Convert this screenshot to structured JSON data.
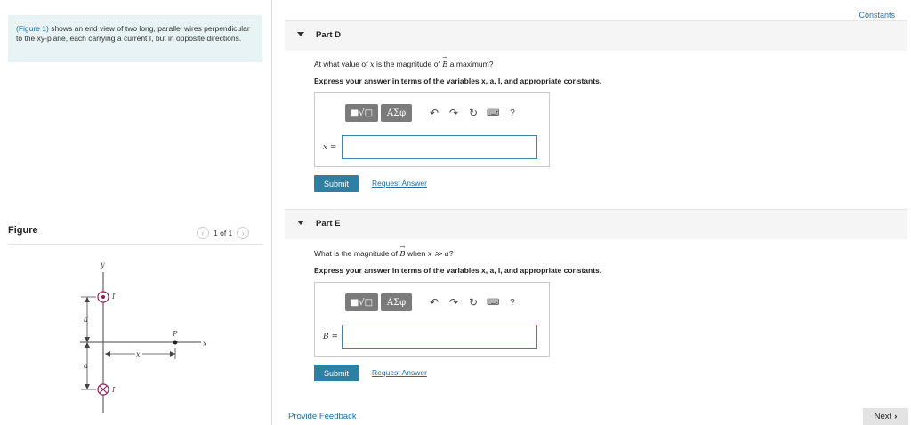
{
  "left_panel": {
    "info_link": "(Figure 1)",
    "info_text": " shows an end view of two long, parallel wires perpendicular to the xy-plane, each carrying a current I, but in opposite directions.",
    "figure_title": "Figure",
    "pager": {
      "prev_icon": "chevron-left-icon",
      "label": "1 of 1",
      "next_icon": "chevron-right-icon"
    },
    "diagram": {
      "y_label": "y",
      "x_label": "x",
      "current_top": "I",
      "current_bottom": "I",
      "point_label": "P",
      "a_top": "a",
      "a_bottom": "a",
      "x_dim": "x",
      "wire_color": "#8b1e5a"
    }
  },
  "constants_link": "Constants",
  "parts": [
    {
      "title": "Part D",
      "question_pre": "At what value of ",
      "question_var": "x",
      "question_mid": " is the magnitude of ",
      "question_vec": "B",
      "question_post": " a maximum?",
      "express": "Express your answer in terms of the variables x, a, I, and appropriate constants.",
      "toolbar": {
        "templates": "■√□",
        "greek": "ΑΣφ",
        "undo": "undo-icon",
        "redo": "redo-icon",
        "reset": "reset-icon",
        "keyboard": "keyboard-icon",
        "help": "?"
      },
      "answer_var": "x =",
      "answer_value": "",
      "submit": "Submit",
      "request": "Request Answer"
    },
    {
      "title": "Part E",
      "question_pre": "What is the magnitude of ",
      "question_vec": "B",
      "question_mid": " when ",
      "question_cond": "x ≫ a",
      "question_post": "?",
      "express": "Express your answer in terms of the variables x, a, I, and appropriate constants.",
      "toolbar": {
        "templates": "■√□",
        "greek": "ΑΣφ",
        "undo": "undo-icon",
        "redo": "redo-icon",
        "reset": "reset-icon",
        "keyboard": "keyboard-icon",
        "help": "?"
      },
      "answer_var": "B =",
      "answer_value": "",
      "submit": "Submit",
      "request": "Request Answer"
    }
  ],
  "footer": {
    "feedback": "Provide Feedback",
    "next": "Next"
  }
}
